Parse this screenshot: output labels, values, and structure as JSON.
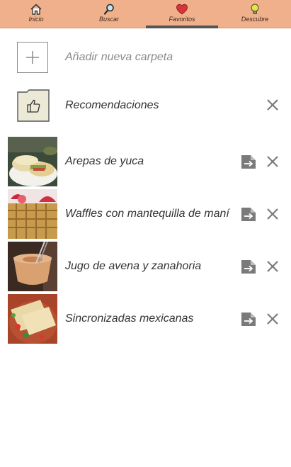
{
  "nav": {
    "tabs": [
      {
        "label": "Inicio",
        "icon": "home-icon"
      },
      {
        "label": "Buscar",
        "icon": "search-icon"
      },
      {
        "label": "Favoritos",
        "icon": "heart-icon"
      },
      {
        "label": "Descubre",
        "icon": "lightbulb-icon"
      }
    ],
    "active": "Favoritos"
  },
  "folders": {
    "add_label": "Añadir nueva carpeta",
    "recommendations_label": "Recomendaciones"
  },
  "favorites": [
    {
      "title": "Arepas de yuca"
    },
    {
      "title": "Waffles con mantequilla de maní"
    },
    {
      "title": "Jugo de avena y zanahoria"
    },
    {
      "title": "Sincronizadas mexicanas"
    }
  ],
  "colors": {
    "nav_background": "#f0b08c",
    "active_indicator": "#555555",
    "icon_gray": "#7a7a7a",
    "heart": "#d9343a"
  }
}
